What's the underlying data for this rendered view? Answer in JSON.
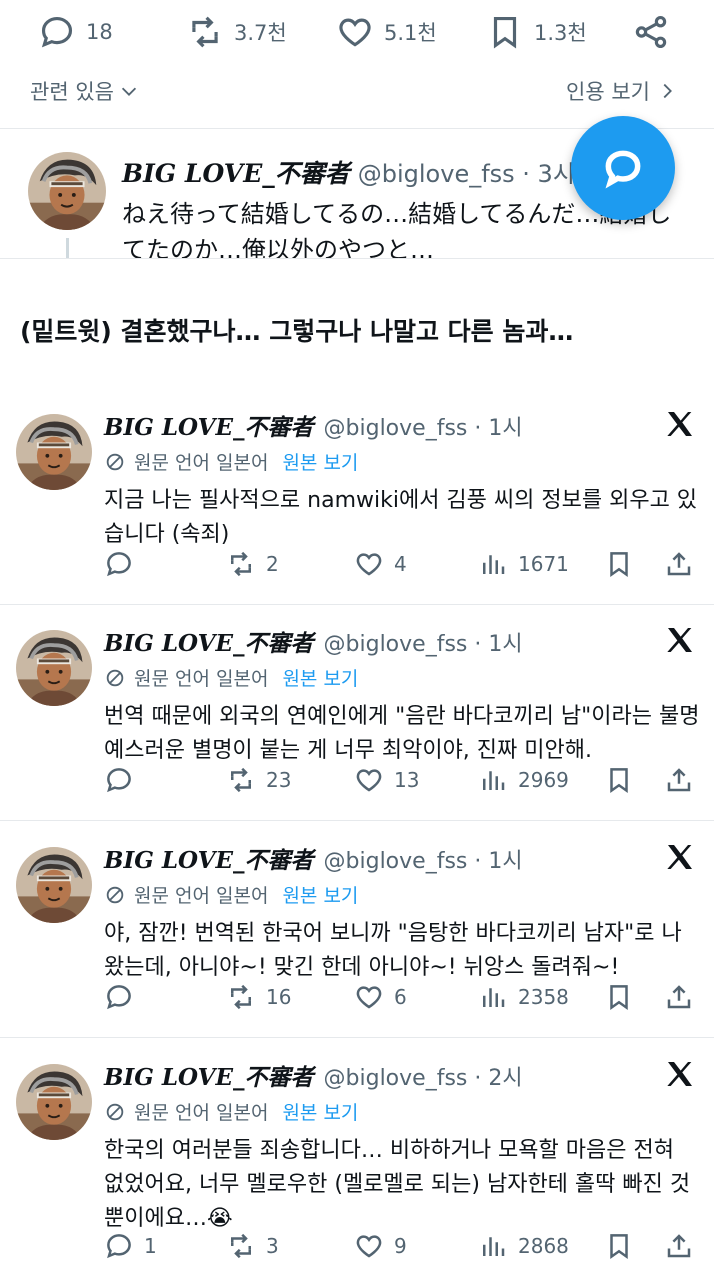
{
  "top_actions": {
    "replies": "18",
    "reposts": "3.7천",
    "likes": "5.1천",
    "bookmarks": "1.3천"
  },
  "related_label": "관련 있음",
  "quotes_label": "인용 보기",
  "quote_tweet": {
    "name": "BIG LOVE_不審者",
    "handle": "@biglove_fss · 3시",
    "text": "ねえ待って結婚してるの…結婚してるんだ…結婚してたのか…俺以外のやつと…"
  },
  "headline": "(밑트윗) 결혼했구나… 그렇구나 나말고 다른 놈과…",
  "translate": {
    "label": "원문 언어 일본어",
    "link": "원본 보기"
  },
  "tweets": [
    {
      "name": "BIG LOVE_不審者",
      "handle": "@biglove_fss · 1시",
      "text": "지금 나는 필사적으로 namwiki에서 김풍 씨의 정보를 외우고 있습니다 (속죄)",
      "replies": "",
      "reposts": "2",
      "likes": "4",
      "views": "1671"
    },
    {
      "name": "BIG LOVE_不審者",
      "handle": "@biglove_fss · 1시",
      "text": "번역 때문에 외국의 연예인에게 \"음란 바다코끼리 남\"이라는 불명예스러운 별명이 붙는 게 너무 최악이야, 진짜 미안해.",
      "replies": "",
      "reposts": "23",
      "likes": "13",
      "views": "2969"
    },
    {
      "name": "BIG LOVE_不審者",
      "handle": "@biglove_fss · 1시",
      "text": "야, 잠깐! 번역된 한국어 보니까 \"음탕한 바다코끼리 남자\"로 나왔는데, 아니야~! 맞긴 한데 아니야~! 뉘앙스 돌려줘~!",
      "replies": "",
      "reposts": "16",
      "likes": "6",
      "views": "2358"
    },
    {
      "name": "BIG LOVE_不審者",
      "handle": "@biglove_fss · 2시",
      "text": "한국의 여러분들 죄송합니다… 비하하거나 모욕할 마음은 전혀 없었어요, 너무 멜로우한 (멜로멜로 되는) 남자한테 홀딱 빠진 것뿐이에요…😭",
      "replies": "1",
      "reposts": "3",
      "likes": "9",
      "views": "2868"
    }
  ],
  "icons": {
    "reply": "reply-icon",
    "repost": "repost-icon",
    "like": "heart-icon",
    "bookmark": "bookmark-icon",
    "share": "share-icon",
    "views": "views-icon",
    "compose": "compose-icon",
    "x_logo": "x-logo-icon"
  },
  "colors": {
    "accent": "#1d9bf0",
    "secondary_text": "#536471",
    "divider": "#e6e9ec"
  }
}
